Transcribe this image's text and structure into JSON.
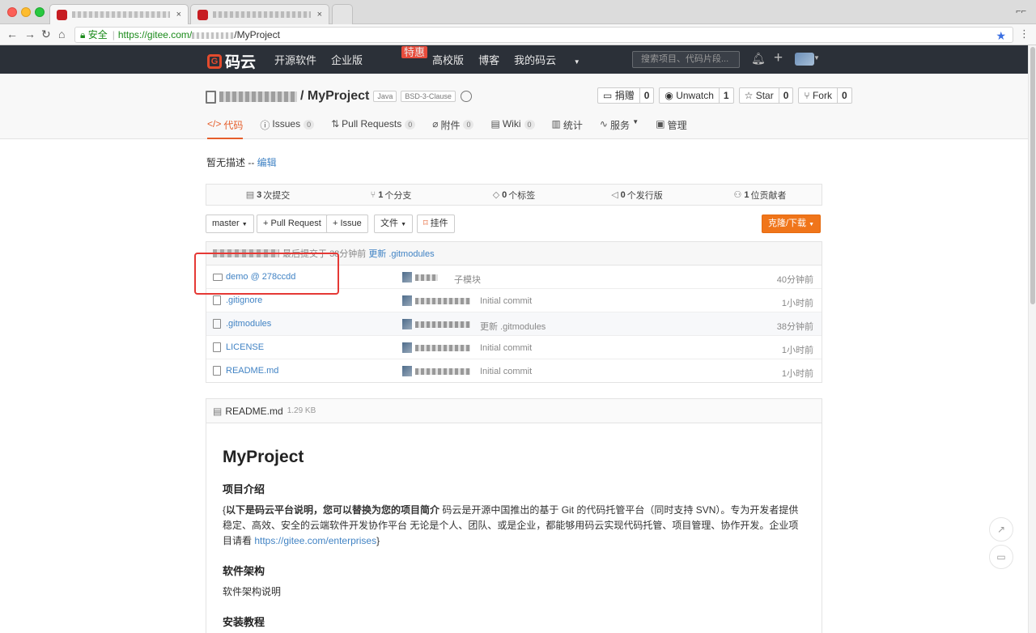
{
  "browser": {
    "secure_label": "安全",
    "url_host": "https://gitee.com/",
    "url_path": "/MyProject",
    "tab_close": "×"
  },
  "header": {
    "logo_text": "码云",
    "nav": [
      "开源软件",
      "企业版",
      "高校版",
      "博客",
      "我的码云"
    ],
    "hot_badge": "特惠",
    "search_placeholder": "搜索项目、代码片段..."
  },
  "project": {
    "name": "MyProject",
    "separator": "/",
    "badges": [
      "Java",
      "BSD-3-Clause"
    ],
    "buttons": [
      {
        "label": "捐赠",
        "count": "0"
      },
      {
        "label": "Unwatch",
        "count": "1"
      },
      {
        "label": "Star",
        "count": "0"
      },
      {
        "label": "Fork",
        "count": "0"
      }
    ],
    "tabs": [
      {
        "label": "代码",
        "count": ""
      },
      {
        "label": "Issues",
        "count": "0"
      },
      {
        "label": "Pull Requests",
        "count": "0"
      },
      {
        "label": "附件",
        "count": "0"
      },
      {
        "label": "Wiki",
        "count": "0"
      },
      {
        "label": "统计",
        "count": ""
      },
      {
        "label": "服务",
        "count": ""
      },
      {
        "label": "管理",
        "count": ""
      }
    ]
  },
  "description": {
    "text": "暂无描述 -- ",
    "edit": "编辑"
  },
  "stats": [
    {
      "num": "3",
      "label": "次提交"
    },
    {
      "num": "1",
      "label": "个分支"
    },
    {
      "num": "0",
      "label": "个标签"
    },
    {
      "num": "0",
      "label": "个发行版"
    },
    {
      "num": "1",
      "label": "位贡献者"
    }
  ],
  "toolbar": {
    "branch": "master",
    "pull_request": "+ Pull Request",
    "issue": "+ Issue",
    "file": "文件",
    "widget": "挂件",
    "clone": "克隆/下载"
  },
  "last_commit": {
    "label": "最后提交于",
    "time": "38分钟前",
    "message": "更新 .gitmodules"
  },
  "files": [
    {
      "name": "demo @ 278ccdd",
      "type": "dir",
      "message": "子模块",
      "time": "40分钟前"
    },
    {
      "name": ".gitignore",
      "type": "file",
      "message": "Initial commit",
      "time": "1小时前"
    },
    {
      "name": ".gitmodules",
      "type": "file",
      "message": "更新 .gitmodules",
      "time": "38分钟前"
    },
    {
      "name": "LICENSE",
      "type": "file",
      "message": "Initial commit",
      "time": "1小时前"
    },
    {
      "name": "README.md",
      "type": "file",
      "message": "Initial commit",
      "time": "1小时前"
    }
  ],
  "readme": {
    "filename": "README.md",
    "size": "1.29 KB",
    "h1": "MyProject",
    "sections": [
      {
        "title": "项目介绍",
        "bold": "以下是码云平台说明，您可以替换为您的项目简介",
        "text": " 码云是开源中国推出的基于 Git 的代码托管平台（同时支持 SVN）。专为开发者提供稳定、高效、安全的云端软件开发协作平台 无论是个人、团队、或是企业，都能够用码云实现代码托管、项目管理、协作开发。企业项目请看 ",
        "link": "https://gitee.com/enterprises"
      },
      {
        "title": "软件架构",
        "text": "软件架构说明"
      },
      {
        "title": "安装教程"
      }
    ]
  }
}
